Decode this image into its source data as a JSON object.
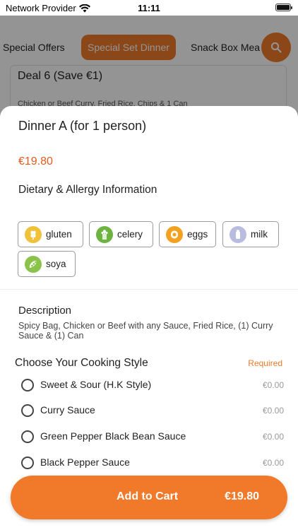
{
  "status_bar": {
    "carrier": "Network Provider",
    "time": "11:11",
    "icons": [
      "wifi-icon",
      "battery-icon"
    ]
  },
  "category_tabs": [
    {
      "label": "Special Offers",
      "active": false
    },
    {
      "label": "Special Set Dinner",
      "active": true
    },
    {
      "label": "Snack Box Mea",
      "active": false
    }
  ],
  "search_icon": "search-icon",
  "background_card": {
    "title": "Deal 6 (Save €1)",
    "description": "Chicken or Beef Curry, Fried Rice, Chips & 1 Can"
  },
  "item": {
    "title": "Dinner A (for 1 person)",
    "price": "€19.80"
  },
  "allergy": {
    "heading": "Dietary & Allergy Information",
    "items": [
      {
        "label": "gluten",
        "icon": "gluten-icon",
        "color": "#efc23a"
      },
      {
        "label": "celery",
        "icon": "celery-icon",
        "color": "#6cb33f"
      },
      {
        "label": "eggs",
        "icon": "eggs-icon",
        "color": "#f2a21e"
      },
      {
        "label": "milk",
        "icon": "milk-icon",
        "color": "#b8bde0"
      },
      {
        "label": "soya",
        "icon": "soya-icon",
        "color": "#8bc34a"
      }
    ]
  },
  "description": {
    "heading": "Description",
    "text": "Spicy Bag, Chicken or Beef with any Sauce, Fried Rice, (1) Curry Sauce & (1) Can"
  },
  "cooking_style": {
    "heading": "Choose Your Cooking Style",
    "required_label": "Required",
    "options": [
      {
        "label": "Sweet & Sour (H.K Style)",
        "price": "€0.00"
      },
      {
        "label": "Curry Sauce",
        "price": "€0.00"
      },
      {
        "label": "Green Pepper Black Bean Sauce",
        "price": "€0.00"
      },
      {
        "label": "Black Pepper Sauce",
        "price": "€0.00"
      }
    ]
  },
  "cart_button": {
    "label": "Add to Cart",
    "price": "€19.80"
  },
  "colors": {
    "accent": "#f07a2a",
    "price": "#e45a1c",
    "required": "#e57b2c"
  }
}
